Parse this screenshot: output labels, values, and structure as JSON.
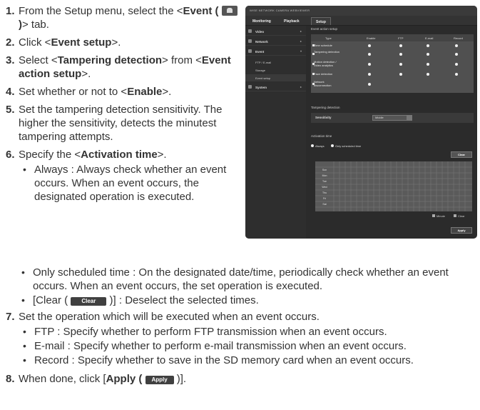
{
  "instructions": {
    "step1": {
      "num": "1.",
      "pre": "From the Setup menu, select the <",
      "bold": "Event (",
      "icon": "event-tab-icon",
      "bold2": ")",
      "post": "> tab."
    },
    "step2": {
      "num": "2.",
      "pre": "Click <",
      "bold": "Event setup",
      "post": ">."
    },
    "step3": {
      "num": "3.",
      "pre": "Select <",
      "bold": "Tampering detection",
      "post": "> from <",
      "bold2": "Event action setup",
      "post2": ">."
    },
    "step4": {
      "num": "4.",
      "pre": "Set whether or not to <",
      "bold": "Enable",
      "post": ">."
    },
    "step5": {
      "num": "5.",
      "text": "Set the tampering detection sensitivity. The higher the sensitivity, detects the minutest tampering attempts."
    },
    "step6": {
      "num": "6.",
      "pre": "Specify the <",
      "bold": "Activation time",
      "post": ">.",
      "bullets": [
        "Always : Always check whether an event occurs. When an event occurs, the designated operation is executed."
      ]
    },
    "step6_more": {
      "scheduled": "Only scheduled time : On the designated date/time, periodically check whether an event occurs. When an event occurs, the set operation is executed.",
      "clear_pre": "[Clear (",
      "clear_btn": "Clear",
      "clear_post": ")] : Deselect the selected times."
    },
    "step7": {
      "num": "7.",
      "text": "Set the operation which will be executed when an event occurs.",
      "bullets": [
        "FTP : Specify whether to perform FTP transmission when an event occurs.",
        "E-mail : Specify whether to perform e-mail transmission when an event occurs.",
        "Record : Specify whether to save in the SD memory card when an event occurs."
      ]
    },
    "step8": {
      "num": "8.",
      "pre": "When done, click [",
      "bold": "Apply (",
      "apply_btn": "Apply",
      "post": ")]."
    }
  },
  "screenshot": {
    "brand": "WiSE NETWORK CAMERA WEBVIEWER",
    "nav": {
      "monitoring": "Monitoring",
      "playback": "Playback",
      "setup": "Setup"
    },
    "sidebar": {
      "video": "Video",
      "network": "Network",
      "event": "Event",
      "sub_ftp": "FTP / E-mail",
      "sub_storage": "Storage",
      "sub_event_setup": "Event setup",
      "system": "System"
    },
    "event_action_title": "Event action setup",
    "table_headers": [
      "Type",
      "Enable",
      "FTP",
      "E-mail",
      "Record"
    ],
    "table_rows": [
      "Time schedule",
      "Tampering detection",
      "Motion detection / Video analytics",
      "Face detection",
      "Network disconnection"
    ],
    "tampering_title": "Tampering detection",
    "sensitivity_label": "Sensitivity",
    "sensitivity_value": "Middle",
    "activation_title": "Activation time",
    "radio_always": "Always",
    "radio_scheduled": "Only scheduled time",
    "clear_btn": "Clear",
    "days": [
      "Sun",
      "Mon",
      "Tue",
      "Wed",
      "Thu",
      "Fri",
      "Sat"
    ],
    "legend_minute": "Minute",
    "legend_clear": "Clear",
    "apply_btn": "Apply"
  }
}
